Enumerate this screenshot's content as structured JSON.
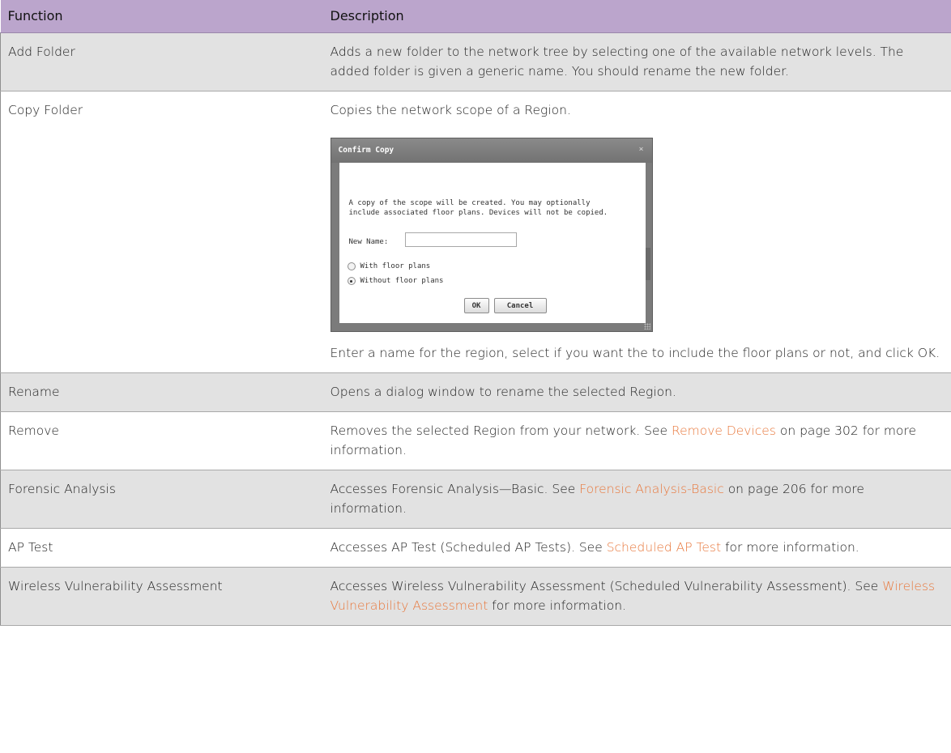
{
  "table": {
    "header": {
      "function": "Function",
      "description": "Description"
    },
    "rows": [
      {
        "function": "Add Folder",
        "description": "Adds a new folder to the network tree by selecting one of the available network levels. The added folder is given a generic name. You should rename the new folder."
      },
      {
        "function": "Copy Folder",
        "description": "Copies the network scope of a Region.",
        "description_after": "Enter a name for the region, select if you want the to include the floor plans or not, and click OK.",
        "dialog": {
          "title": "Confirm Copy",
          "close": "×",
          "message": "A copy of the scope will be created. You may optionally include associated floor plans. Devices will not be copied.",
          "name_label": "New Name:",
          "name_value": "",
          "option_with": "With floor plans",
          "option_without": "Without floor plans",
          "selected_option": "Without floor plans",
          "ok": "OK",
          "cancel": "Cancel"
        }
      },
      {
        "function": "Rename",
        "description": "Opens a dialog window to rename the selected Region."
      },
      {
        "function": "Remove",
        "desc_pre": "Removes the selected Region from your network. See ",
        "desc_link": "Remove Devices",
        "desc_post": " on page 302 for more information."
      },
      {
        "function": "Forensic Analysis",
        "desc_pre": "Accesses Forensic Analysis—Basic. See ",
        "desc_link": "Forensic Analysis-Basic",
        "desc_post": " on page 206 for more information."
      },
      {
        "function": "AP Test",
        "desc_pre": "Accesses AP Test (Scheduled AP Tests). See ",
        "desc_link": "Scheduled AP Test",
        "desc_post": " for more information."
      },
      {
        "function": "Wireless Vulnerability Assessment",
        "desc_pre": "Accesses Wireless Vulnerability Assessment (Scheduled Vulnerability Assessment). See ",
        "desc_link": "Wireless Vulnerability Assessment",
        "desc_post": " for more information."
      }
    ]
  },
  "colors": {
    "header_bg": "#bba5cc",
    "shaded_row_bg": "#e2e2e2",
    "link": "#e8773b"
  }
}
